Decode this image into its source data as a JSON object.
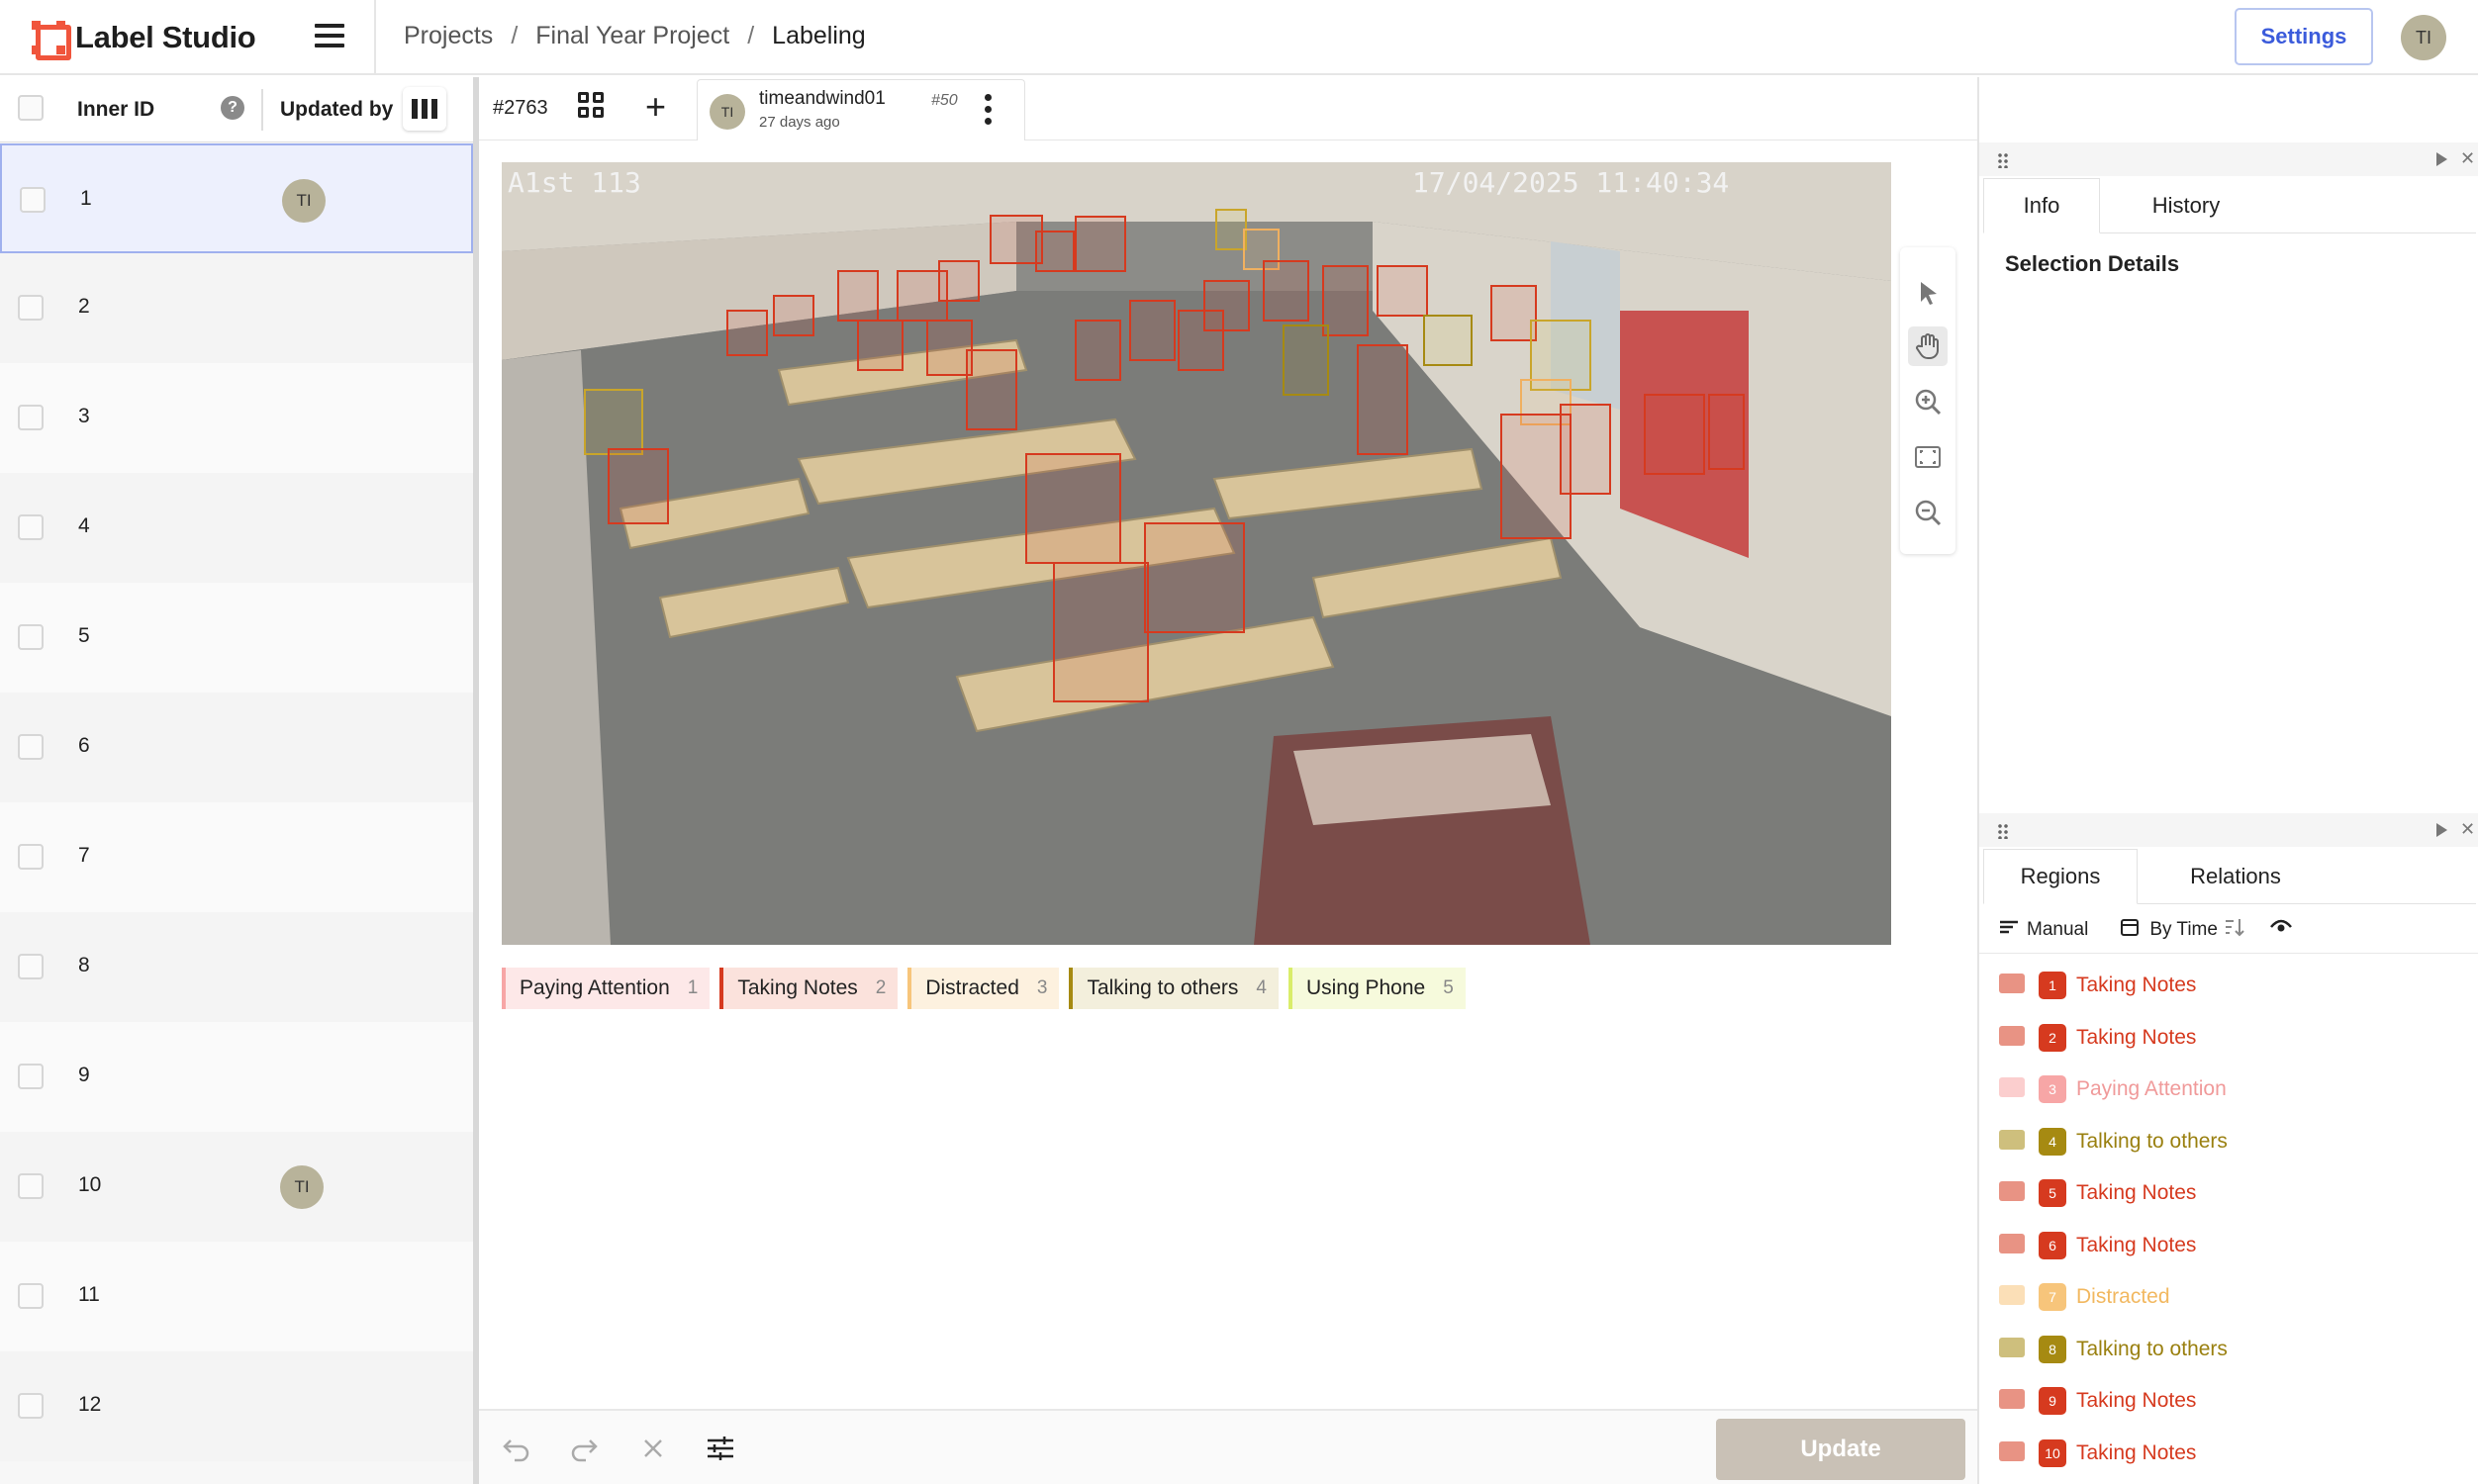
{
  "app": {
    "name": "Label Studio"
  },
  "breadcrumb": [
    "Projects",
    "Final Year Project",
    "Labeling"
  ],
  "header": {
    "settings_label": "Settings",
    "user_initials": "TI"
  },
  "tasklist": {
    "col_inner_id": "Inner ID",
    "col_updated_by": "Updated by",
    "help_glyph": "?",
    "rows": [
      {
        "id": "1",
        "updated_by": "TI",
        "selected": true
      },
      {
        "id": "2",
        "updated_by": ""
      },
      {
        "id": "3",
        "updated_by": ""
      },
      {
        "id": "4",
        "updated_by": ""
      },
      {
        "id": "5",
        "updated_by": ""
      },
      {
        "id": "6",
        "updated_by": ""
      },
      {
        "id": "7",
        "updated_by": ""
      },
      {
        "id": "8",
        "updated_by": ""
      },
      {
        "id": "9",
        "updated_by": ""
      },
      {
        "id": "10",
        "updated_by": "TI"
      },
      {
        "id": "11",
        "updated_by": ""
      },
      {
        "id": "12",
        "updated_by": ""
      }
    ]
  },
  "task": {
    "id": "#2763",
    "annotation": {
      "initials": "TI",
      "user": "timeandwind01",
      "number": "#50",
      "time": "27 days ago"
    }
  },
  "image": {
    "overlay_left": "A1st 113",
    "overlay_right": "17/04/2025 11:40:34"
  },
  "labels": [
    {
      "name": "Paying Attention",
      "hotkey": "1",
      "color": "#f7a6a6",
      "bg": "#fde8e8"
    },
    {
      "name": "Taking Notes",
      "hotkey": "2",
      "color": "#d63a1f",
      "bg": "#fbe2dc"
    },
    {
      "name": "Distracted",
      "hotkey": "3",
      "color": "#f7c57b",
      "bg": "#fdf1df"
    },
    {
      "name": "Talking to others",
      "hotkey": "4",
      "color": "#a68a12",
      "bg": "#f3efdc"
    },
    {
      "name": "Using Phone",
      "hotkey": "5",
      "color": "#d9ed6a",
      "bg": "#f6fadc"
    }
  ],
  "bottom": {
    "update_label": "Update"
  },
  "right_panel": {
    "top_tabs": [
      "Info",
      "History"
    ],
    "selection_details": "Selection Details",
    "bottom_tabs": [
      "Regions",
      "Relations"
    ],
    "toolbar": {
      "manual": "Manual",
      "by_time": "By Time"
    },
    "regions": [
      {
        "num": "1",
        "label": "Taking Notes",
        "color": "#d63a1f",
        "text_color": "#d63a1f"
      },
      {
        "num": "2",
        "label": "Taking Notes",
        "color": "#d63a1f",
        "text_color": "#d63a1f"
      },
      {
        "num": "3",
        "label": "Paying Attention",
        "color": "#f7a6a6",
        "text_color": "#f09a9a"
      },
      {
        "num": "4",
        "label": "Talking to others",
        "color": "#a68a12",
        "text_color": "#9a8010"
      },
      {
        "num": "5",
        "label": "Taking Notes",
        "color": "#d63a1f",
        "text_color": "#d63a1f"
      },
      {
        "num": "6",
        "label": "Taking Notes",
        "color": "#d63a1f",
        "text_color": "#d63a1f"
      },
      {
        "num": "7",
        "label": "Distracted",
        "color": "#f7c57b",
        "text_color": "#f2b860"
      },
      {
        "num": "8",
        "label": "Talking to others",
        "color": "#a68a12",
        "text_color": "#9a8010"
      },
      {
        "num": "9",
        "label": "Taking Notes",
        "color": "#d63a1f",
        "text_color": "#d63a1f"
      },
      {
        "num": "10",
        "label": "Taking Notes",
        "color": "#d63a1f",
        "text_color": "#d63a1f"
      }
    ]
  }
}
